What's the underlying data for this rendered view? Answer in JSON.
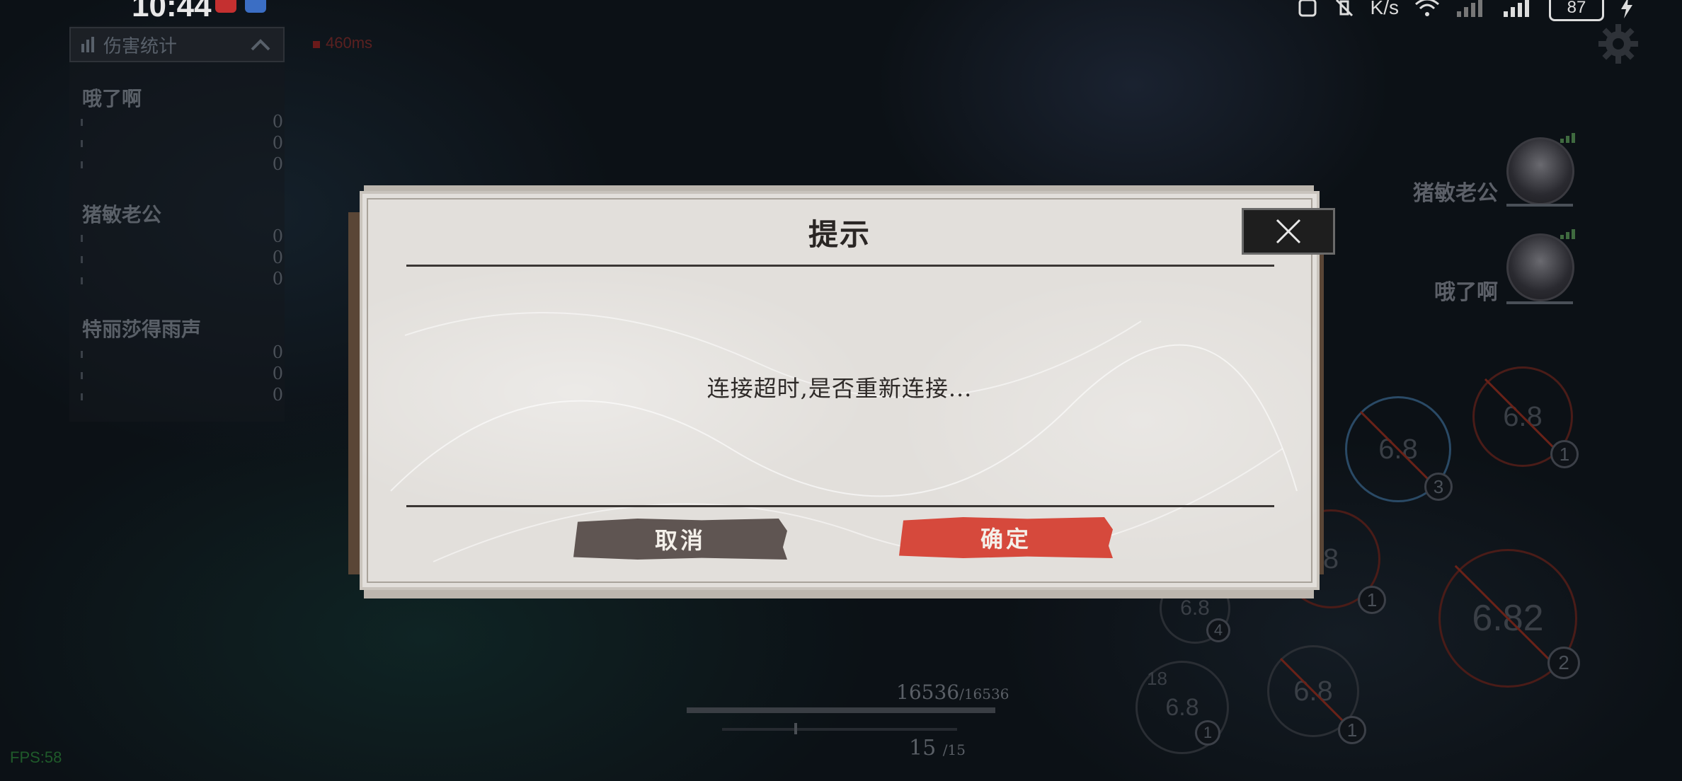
{
  "status_bar": {
    "time": "10:44",
    "speed_unit": "K/s",
    "battery": "87"
  },
  "damage_stats": {
    "title": "伤害统计",
    "ping": "460ms",
    "players": [
      {
        "name": "哦了啊",
        "values": [
          "0",
          "0",
          "0"
        ]
      },
      {
        "name": "猪敏老公",
        "values": [
          "0",
          "0",
          "0"
        ]
      },
      {
        "name": "特丽莎得雨声",
        "values": [
          "0",
          "0",
          "0"
        ]
      }
    ]
  },
  "team": {
    "members": [
      {
        "name": "猪敏老公"
      },
      {
        "name": "哦了啊"
      }
    ]
  },
  "skills": [
    {
      "value": "6.8",
      "badge": "1"
    },
    {
      "value": "6.8",
      "badge": "3"
    },
    {
      "value": "8",
      "badge": "1"
    },
    {
      "value": "6.8",
      "badge": "4"
    },
    {
      "value": "6.82",
      "badge": "2"
    },
    {
      "value": "6.8",
      "badge": "1"
    },
    {
      "value": "6.8",
      "badge": "1",
      "extra": "18"
    }
  ],
  "hud": {
    "hp_current": "16536",
    "hp_max": "/16536",
    "ammo_current": "15",
    "ammo_max": "/15",
    "fps": "FPS:58"
  },
  "dialog": {
    "title": "提示",
    "message": "连接超时,是否重新连接...",
    "cancel_label": "取消",
    "confirm_label": "确定",
    "close_icon": "close-x-icon"
  },
  "colors": {
    "confirm": "#d6493c",
    "cancel": "#5f5552",
    "dialog_bg": "#e2dfdb"
  }
}
